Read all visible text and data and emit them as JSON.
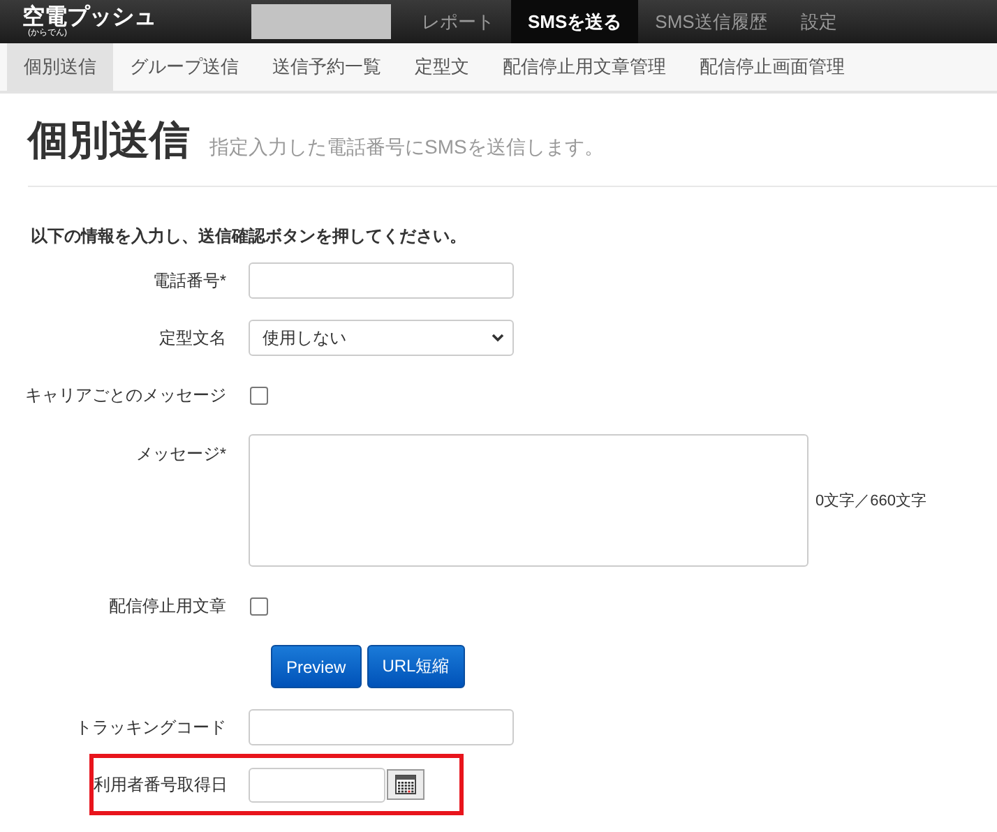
{
  "header": {
    "logo": "空電プッシュ",
    "logo_reading": "(からでん)",
    "nav": [
      {
        "label": "レポート",
        "selected": false
      },
      {
        "label": "SMSを送る",
        "selected": true
      },
      {
        "label": "SMS送信履歴",
        "selected": false
      },
      {
        "label": "設定",
        "selected": false
      }
    ]
  },
  "subnav": [
    {
      "label": "個別送信",
      "selected": true
    },
    {
      "label": "グループ送信",
      "selected": false
    },
    {
      "label": "送信予約一覧",
      "selected": false
    },
    {
      "label": "定型文",
      "selected": false
    },
    {
      "label": "配信停止用文章管理",
      "selected": false
    },
    {
      "label": "配信停止画面管理",
      "selected": false
    }
  ],
  "page": {
    "title": "個別送信",
    "subtitle": "指定入力した電話番号にSMSを送信します。",
    "instruction": "以下の情報を入力し、送信確認ボタンを押してください。"
  },
  "form": [
    {
      "kind": "text",
      "label": "電話番号*",
      "highlighted": false
    },
    {
      "kind": "select",
      "label": "定型文名",
      "value": "使用しない",
      "highlighted": false
    },
    {
      "kind": "checkbox",
      "label": "キャリアごとのメッセージ",
      "checked": false,
      "highlighted": false
    },
    {
      "kind": "textarea",
      "label": "メッセージ*",
      "counter": "0文字／660文字",
      "highlighted": false
    },
    {
      "kind": "checkbox",
      "label": "配信停止用文章",
      "checked": false,
      "highlighted": false
    },
    {
      "kind": "buttons",
      "buttons": [
        "Preview",
        "URL短縮"
      ],
      "highlighted": false
    },
    {
      "kind": "text",
      "label": "トラッキングコード",
      "highlighted": false
    },
    {
      "kind": "date",
      "label": "利用者番号取得日",
      "highlighted": true
    }
  ]
}
